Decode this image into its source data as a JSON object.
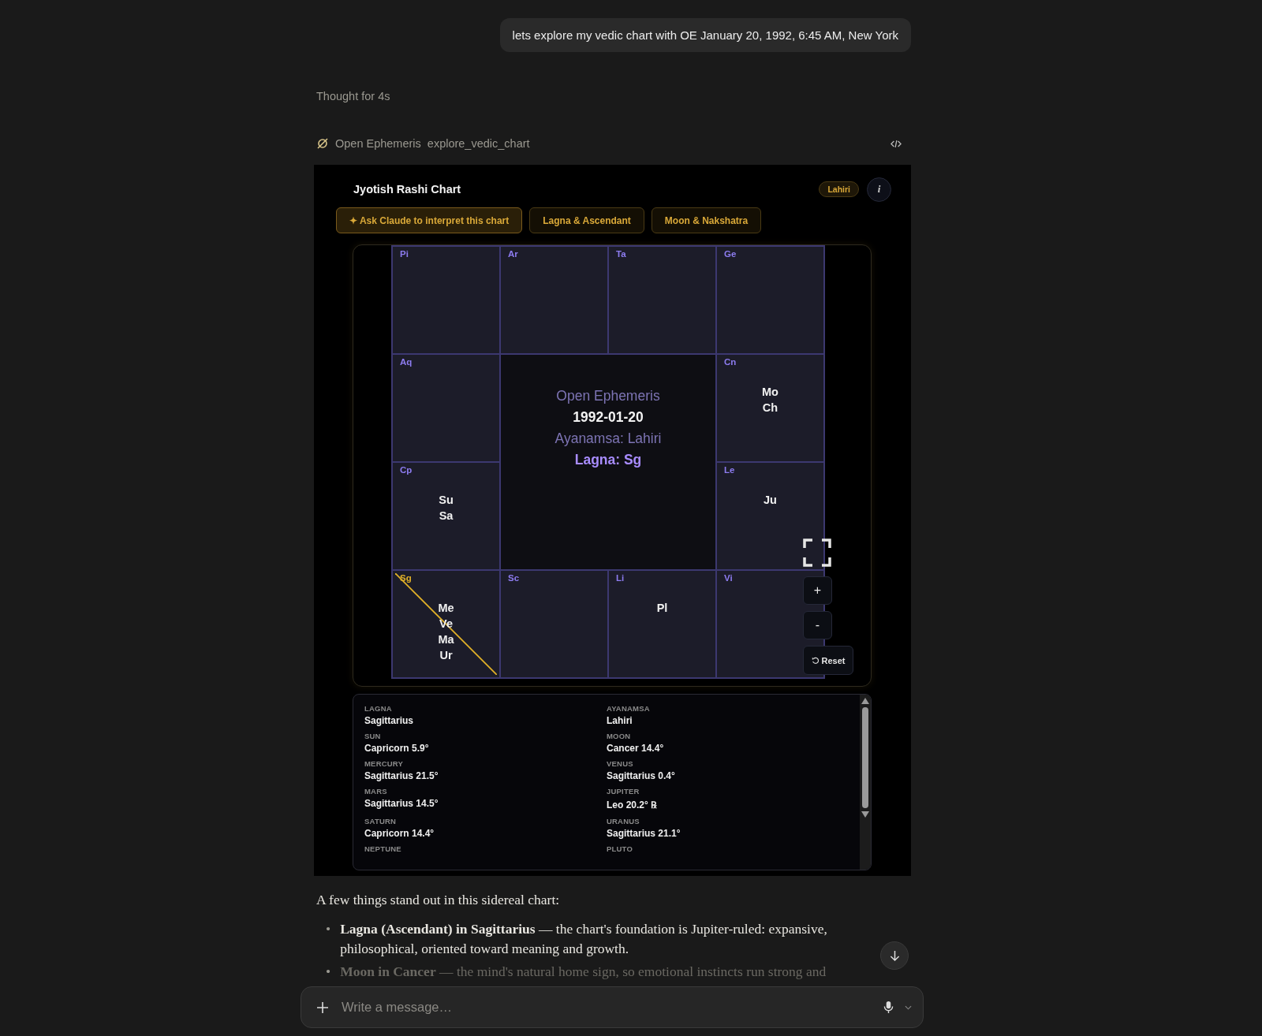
{
  "user_message": "lets explore my vedic chart with OE January 20, 1992, 6:45 AM, New York",
  "thought": "Thought for 4s",
  "tool_call": {
    "provider": "Open Ephemeris",
    "tool": "explore_vedic_chart"
  },
  "widget": {
    "title": "Jyotish Rashi Chart",
    "badge": "Lahiri",
    "info_button": "i",
    "actions": [
      {
        "label": "✦ Ask Claude to interpret this chart",
        "primary": true
      },
      {
        "label": "Lagna & Ascendant",
        "primary": false
      },
      {
        "label": "Moon & Nakshatra",
        "primary": false
      }
    ],
    "houses": [
      {
        "sign": "Pi",
        "ascendant": false
      },
      {
        "sign": "Ar",
        "ascendant": false
      },
      {
        "sign": "Ta",
        "ascendant": false
      },
      {
        "sign": "Ge",
        "ascendant": false
      },
      {
        "sign": "Aq",
        "ascendant": false
      },
      {
        "sign": "Cn",
        "planets": [
          "Mo",
          "Ch"
        ],
        "ascendant": false
      },
      {
        "sign": "Cp",
        "planets": [
          "Su",
          "Sa"
        ],
        "ascendant": false
      },
      {
        "sign": "Le",
        "planets": [
          "Ju"
        ],
        "ascendant": false
      },
      {
        "sign": "Sg",
        "planets": [
          "Me",
          "Ve",
          "Ma",
          "Ur"
        ],
        "ascendant": true
      },
      {
        "sign": "Sc",
        "ascendant": false
      },
      {
        "sign": "Li",
        "planets": [
          "Pl"
        ],
        "ascendant": false
      },
      {
        "sign": "Vi",
        "ascendant": false
      }
    ],
    "center": {
      "source": "Open Ephemeris",
      "date": "1992-01-20",
      "ayanamsa": "Ayanamsa: Lahiri",
      "lagna": "Lagna: Sg"
    },
    "zoom_controls": {
      "zoom_in": "+",
      "zoom_out": "-",
      "reset": "Reset"
    },
    "details": [
      {
        "label": "LAGNA",
        "value": "Sagittarius"
      },
      {
        "label": "AYANAMSA",
        "value": "Lahiri"
      },
      {
        "label": "SUN",
        "value": "Capricorn 5.9°"
      },
      {
        "label": "MOON",
        "value": "Cancer 14.4°"
      },
      {
        "label": "MERCURY",
        "value": "Sagittarius 21.5°"
      },
      {
        "label": "VENUS",
        "value": "Sagittarius 0.4°"
      },
      {
        "label": "MARS",
        "value": "Sagittarius 14.5°"
      },
      {
        "label": "JUPITER",
        "value": "Leo 20.2° ℞"
      },
      {
        "label": "SATURN",
        "value": "Capricorn 14.4°"
      },
      {
        "label": "URANUS",
        "value": "Sagittarius 21.1°"
      },
      {
        "label": "NEPTUNE"
      },
      {
        "label": "PLUTO"
      }
    ]
  },
  "response": {
    "intro": "A few things stand out in this sidereal chart:",
    "bullets": [
      {
        "marker": "•",
        "text": "**Lagna (Ascendant) in Sagittarius** — the chart's foundation is Jupiter-ruled: expansive, philosophical, oriented toward meaning and growth."
      },
      {
        "marker": "•",
        "text": "**Moon in Cancer** — the mind's natural home sign, so emotional instincts run strong and"
      }
    ]
  },
  "composer": {
    "placeholder": "Write a message…"
  }
}
